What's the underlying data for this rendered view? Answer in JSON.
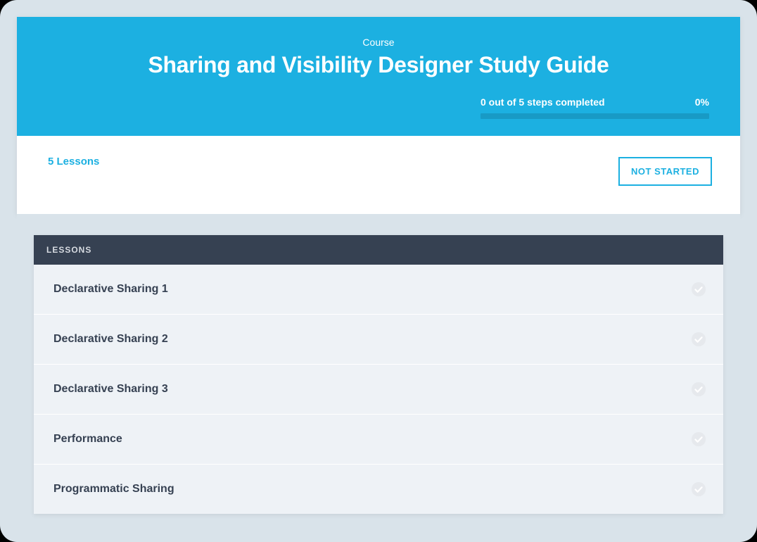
{
  "header": {
    "kicker": "Course",
    "title": "Sharing and Visibility Designer Study Guide",
    "progress_text": "0 out of 5 steps completed",
    "progress_percent": "0%"
  },
  "info": {
    "lessons_count": "5 Lessons",
    "status_label": "NOT STARTED"
  },
  "lessons": {
    "header": "LESSONS",
    "items": [
      {
        "title": "Declarative Sharing 1"
      },
      {
        "title": "Declarative Sharing 2"
      },
      {
        "title": "Declarative Sharing 3"
      },
      {
        "title": "Performance"
      },
      {
        "title": "Programmatic Sharing"
      }
    ]
  }
}
